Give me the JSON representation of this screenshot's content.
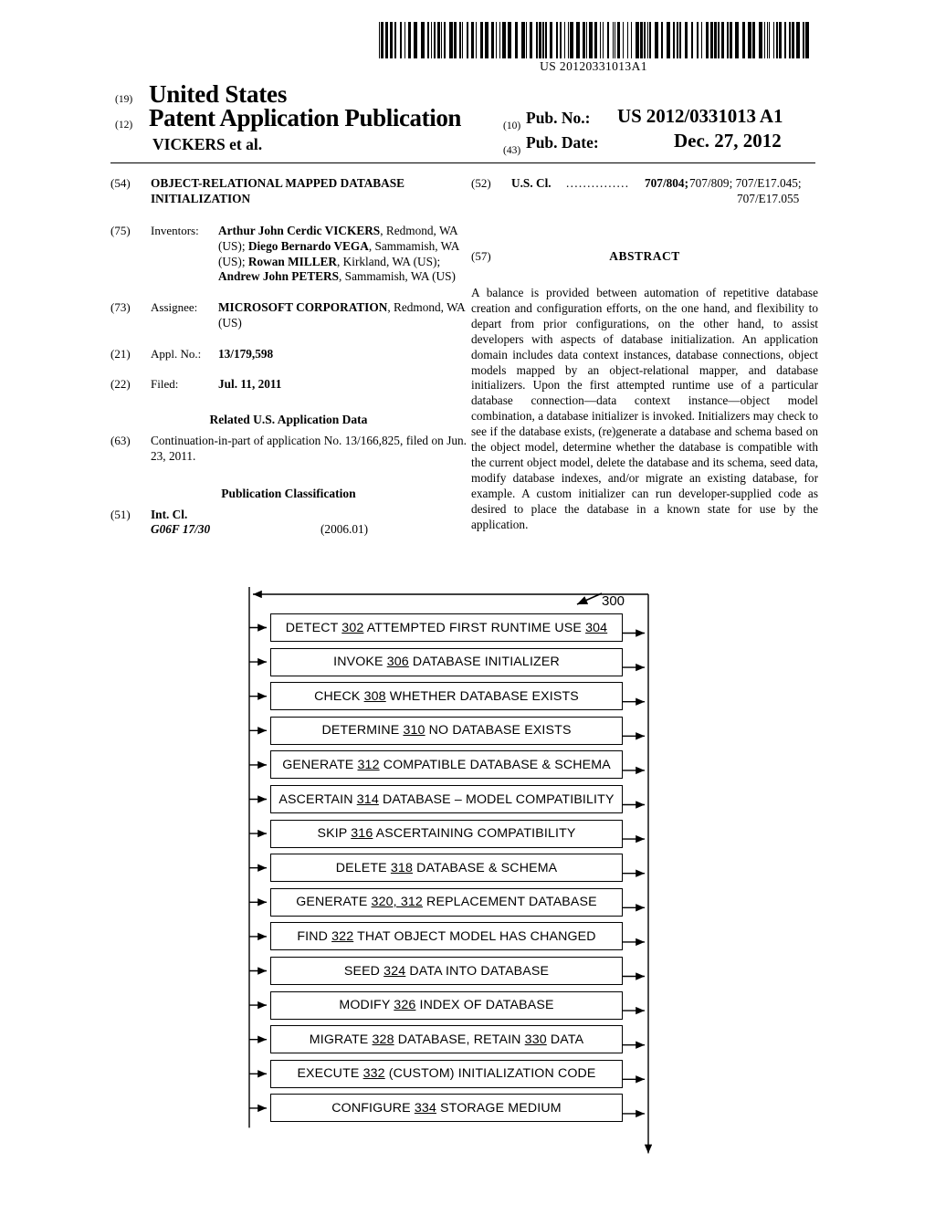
{
  "barcode": {
    "number": "US 20120331013A1"
  },
  "header": {
    "country_inid": "(19)",
    "country": "United States",
    "doc_type_inid": "(12)",
    "doc_type": "Patent Application Publication",
    "applicant": "VICKERS et al.",
    "pub_no_inid": "(10)",
    "pub_no_label": "Pub. No.:",
    "pub_no_value": "US 2012/0331013 A1",
    "pub_date_inid": "(43)",
    "pub_date_label": "Pub. Date:",
    "pub_date_value": "Dec. 27, 2012"
  },
  "left_column": {
    "title_inid": "(54)",
    "title": "OBJECT-RELATIONAL MAPPED DATABASE INITIALIZATION",
    "inventors_inid": "(75)",
    "inventors_label": "Inventors:",
    "inventors_html": "<b>Arthur John Cerdic VICKERS</b>, Redmond, WA (US); <b>Diego Bernardo VEGA</b>, Sammamish, WA (US); <b>Rowan MILLER</b>, Kirkland, WA (US); <b>Andrew John PETERS</b>, Sammamish, WA (US)",
    "assignee_inid": "(73)",
    "assignee_label": "Assignee:",
    "assignee_html": "<b>MICROSOFT CORPORATION</b>, Redmond, WA (US)",
    "appl_no_inid": "(21)",
    "appl_no_label": "Appl. No.:",
    "appl_no_value": "13/179,598",
    "filed_inid": "(22)",
    "filed_label": "Filed:",
    "filed_value": "Jul. 11, 2011",
    "related_head": "Related U.S. Application Data",
    "related_inid": "(63)",
    "related_text": "Continuation-in-part of application No. 13/166,825, filed on Jun. 23, 2011.",
    "pub_class_head": "Publication Classification",
    "int_cl_inid": "(51)",
    "int_cl_label": "Int. Cl.",
    "int_cl_code": "G06F 17/30",
    "int_cl_version": "(2006.01)"
  },
  "right_column": {
    "us_cl_inid": "(52)",
    "us_cl_label": "U.S. Cl.",
    "us_cl_dots": "...............",
    "us_cl_primary": "707/804;",
    "us_cl_rest": "707/809; 707/E17.045;",
    "us_cl_line2": "707/E17.055",
    "abstract_inid": "(57)",
    "abstract_label": "ABSTRACT",
    "abstract_text": "A balance is provided between automation of repetitive database creation and configuration efforts, on the one hand, and flexibility to depart from prior configurations, on the other hand, to assist developers with aspects of database initialization. An application domain includes data context instances, database connections, object models mapped by an object-relational mapper, and database initializers. Upon the first attempted runtime use of a particular database connection—data context instance—object model combination, a database initializer is invoked. Initializers may check to see if the database exists, (re)generate a database and schema based on the object model, determine whether the database is compatible with the current object model, delete the database and its schema, seed data, modify database indexes, and/or migrate an existing database, for example. A custom initializer can run developer-supplied code as desired to place the database in a known state for use by the application."
  },
  "figure": {
    "reference_numeral": "300",
    "steps": [
      {
        "html": "DETECT <u>302</u> ATTEMPTED FIRST RUNTIME USE <u>304</u>",
        "name": "detect-302"
      },
      {
        "html": "INVOKE <u>306</u> DATABASE INITIALIZER",
        "name": "invoke-306"
      },
      {
        "html": "CHECK <u>308</u> WHETHER DATABASE EXISTS",
        "name": "check-308"
      },
      {
        "html": "DETERMINE <u>310</u> NO DATABASE EXISTS",
        "name": "determine-310"
      },
      {
        "html": "GENERATE <u>312</u> COMPATIBLE DATABASE &amp; SCHEMA",
        "name": "generate-312"
      },
      {
        "html": "ASCERTAIN <u>314</u> DATABASE – MODEL COMPATIBILITY",
        "name": "ascertain-314"
      },
      {
        "html": "SKIP <u>316</u> ASCERTAINING COMPATIBILITY",
        "name": "skip-316"
      },
      {
        "html": "DELETE <u>318</u> DATABASE &amp; SCHEMA",
        "name": "delete-318"
      },
      {
        "html": "GENERATE <u>320, 312</u> REPLACEMENT DATABASE",
        "name": "generate-320-312"
      },
      {
        "html": "FIND <u>322</u> THAT OBJECT MODEL HAS CHANGED",
        "name": "find-322"
      },
      {
        "html": "SEED <u>324</u> DATA INTO DATABASE",
        "name": "seed-324"
      },
      {
        "html": "MODIFY <u>326</u> INDEX OF DATABASE",
        "name": "modify-326"
      },
      {
        "html": "MIGRATE <u>328</u> DATABASE, RETAIN <u>330</u> DATA",
        "name": "migrate-328"
      },
      {
        "html": "EXECUTE <u>332</u> (CUSTOM) INITIALIZATION CODE",
        "name": "execute-332"
      },
      {
        "html": "CONFIGURE <u>334</u> STORAGE MEDIUM",
        "name": "configure-334"
      }
    ]
  }
}
